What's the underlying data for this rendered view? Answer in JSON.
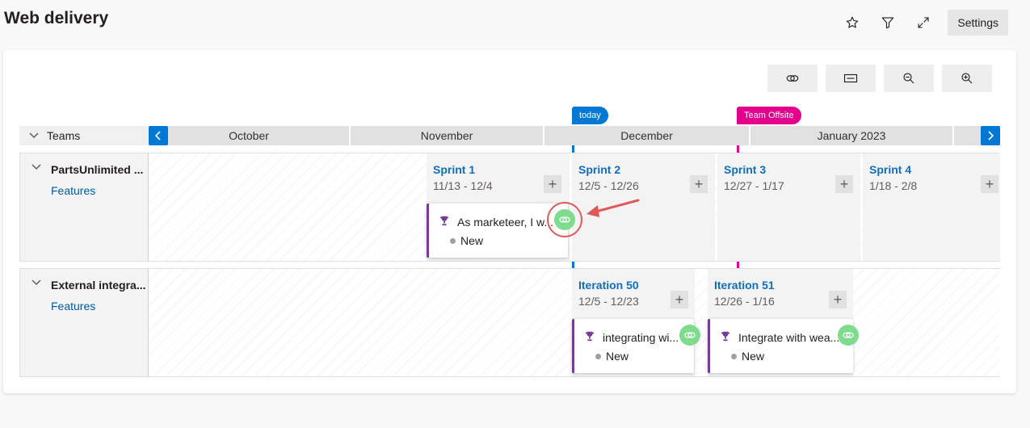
{
  "page": {
    "title": "Web delivery"
  },
  "top_actions": {
    "settings_label": "Settings",
    "icons": [
      "star-icon",
      "filter-icon",
      "expand-icon"
    ]
  },
  "toolbar": {
    "icons": [
      "dependency-link-icon",
      "card-fields-icon",
      "zoom-out-icon",
      "zoom-in-icon"
    ]
  },
  "markers": {
    "today": "today",
    "offsite": "Team Offsite"
  },
  "timeline": {
    "teams_header": "Teams",
    "months": [
      "October",
      "November",
      "December",
      "January 2023"
    ]
  },
  "teams": [
    {
      "name": "PartsUnlimited ...",
      "backlog": "Features",
      "iterations": [
        {
          "title": "Sprint 1",
          "range": "11/13 - 12/4"
        },
        {
          "title": "Sprint 2",
          "range": "12/5 - 12/26"
        },
        {
          "title": "Sprint 3",
          "range": "12/27 - 1/17"
        },
        {
          "title": "Sprint 4",
          "range": "1/18 - 2/8"
        }
      ],
      "cards": [
        {
          "title": "As marketeer, I w...",
          "state": "New"
        }
      ]
    },
    {
      "name": "External integra...",
      "backlog": "Features",
      "iterations": [
        {
          "title": "Iteration 50",
          "range": "12/5 - 12/23"
        },
        {
          "title": "Iteration 51",
          "range": "12/26 - 1/16"
        }
      ],
      "cards": [
        {
          "title": "integrating wi...",
          "state": "New"
        },
        {
          "title": "Integrate with wea...",
          "state": "New"
        }
      ]
    }
  ],
  "colors": {
    "accent": "#0078d4",
    "offsite": "#e3008c",
    "epic": "#773b93",
    "link_badge": "#7fdc8f",
    "annotation": "#e05858"
  }
}
